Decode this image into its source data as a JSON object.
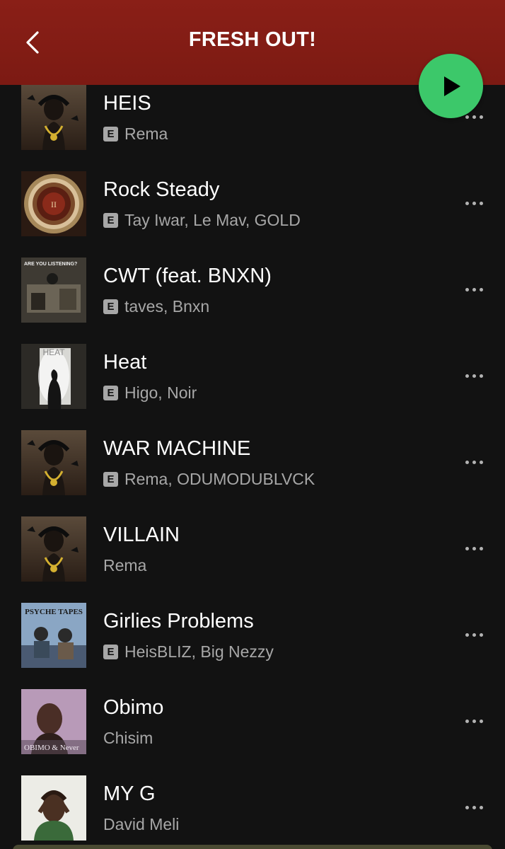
{
  "header": {
    "title": "FRESH OUT!",
    "back_icon": "chevron-left-icon",
    "play_icon": "play-icon",
    "background": "#7c1a13",
    "play_color": "#3cc86a"
  },
  "explicit_label": "E",
  "tracks": [
    {
      "title": "HEIS",
      "artists": "Rema",
      "explicit": true,
      "art": "heis"
    },
    {
      "title": "Rock Steady",
      "artists": "Tay Iwar, Le Mav, GOLD",
      "explicit": true,
      "art": "rock"
    },
    {
      "title": "CWT (feat. BNXN)",
      "artists": "taves, Bnxn",
      "explicit": true,
      "art": "cwt"
    },
    {
      "title": "Heat",
      "artists": "Higo, Noir",
      "explicit": true,
      "art": "heat"
    },
    {
      "title": "WAR MACHINE",
      "artists": "Rema, ODUMODUBLVCK",
      "explicit": true,
      "art": "heis"
    },
    {
      "title": "VILLAIN",
      "artists": "Rema",
      "explicit": false,
      "art": "heis"
    },
    {
      "title": "Girlies Problems",
      "artists": "HeisBLIZ, Big Nezzy",
      "explicit": true,
      "art": "psyche"
    },
    {
      "title": "Obimo",
      "artists": "Chisim",
      "explicit": false,
      "art": "obimo"
    },
    {
      "title": "MY G",
      "artists": "David Meli",
      "explicit": false,
      "art": "myg"
    }
  ],
  "art_text": {
    "cwt": "ARE YOU LISTENING?",
    "heat": "HEAT",
    "psyche": "PSYCHE TAPES",
    "obimo": "OBIMO & Never"
  }
}
